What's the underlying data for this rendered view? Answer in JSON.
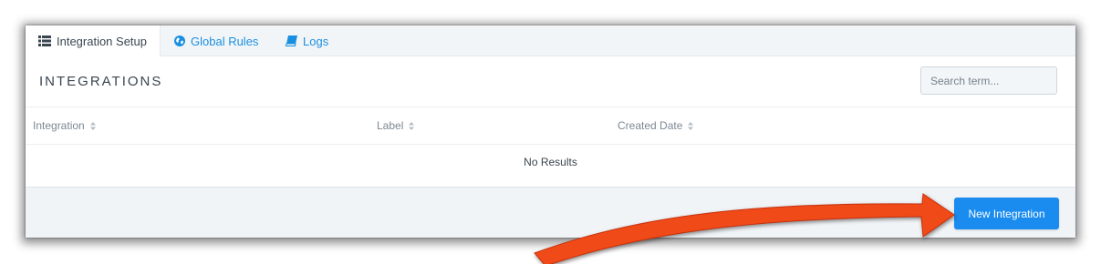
{
  "tabs": [
    {
      "label": "Integration Setup",
      "icon": "list-icon",
      "active": true
    },
    {
      "label": "Global Rules",
      "icon": "globe-icon",
      "active": false
    },
    {
      "label": "Logs",
      "icon": "book-icon",
      "active": false
    }
  ],
  "main": {
    "title": "INTEGRATIONS",
    "search_placeholder": "Search term..."
  },
  "table": {
    "columns": [
      "Integration",
      "Label",
      "Created Date"
    ],
    "empty_text": "No Results"
  },
  "footer": {
    "new_button": "New Integration"
  },
  "annotation": {
    "arrow_icon": "arrow-icon",
    "arrow_color": "#f04a18"
  },
  "colors": {
    "accent": "#1a8cf0",
    "tab_bar": "#f2f5f8",
    "footer": "#f1f4f7"
  }
}
